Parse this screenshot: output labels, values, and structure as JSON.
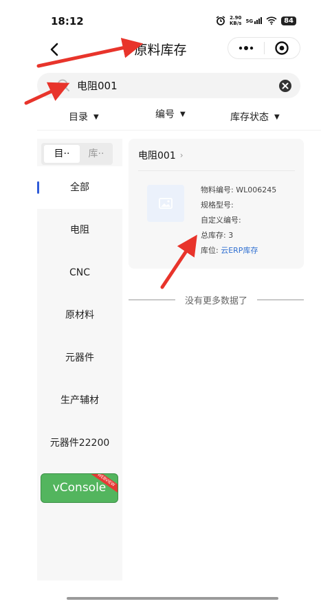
{
  "status_bar": {
    "time": "18:12",
    "net_speed_value": "2.90",
    "net_speed_unit": "KB/s",
    "network": "5G",
    "battery": "84"
  },
  "nav": {
    "title": "原料库存",
    "back_icon": "chevron-left-icon",
    "more_icon": "more-dots-icon",
    "close_icon": "target-close-icon"
  },
  "search": {
    "value": "电阻001",
    "icon": "search-icon",
    "clear_icon": "clear-icon"
  },
  "filters": [
    {
      "label": "目录"
    },
    {
      "label": "编号"
    },
    {
      "label": "库存状态"
    }
  ],
  "sidebar": {
    "tabs": [
      {
        "label": "目··"
      },
      {
        "label": "库··"
      }
    ],
    "items": [
      {
        "label": "全部"
      },
      {
        "label": "电阻"
      },
      {
        "label": "CNC"
      },
      {
        "label": "原材料"
      },
      {
        "label": "元器件"
      },
      {
        "label": "生产辅材"
      },
      {
        "label": "元器件22200"
      }
    ],
    "active_index": 0
  },
  "vconsole": {
    "label": "vConsole",
    "ribbon": "WEBVIEW"
  },
  "product": {
    "name": "电阻001",
    "code_label": "物料编号:",
    "code_value": "WL006245",
    "spec_label": "规格型号:",
    "custom_code_label": "自定义编号:",
    "stock_label": "总库存:",
    "stock_value": "3",
    "location_label": "库位:",
    "location_value": "云ERP库存"
  },
  "list_end": "没有更多数据了",
  "colors": {
    "accent": "#2f5bd8",
    "link": "#2f6fd1",
    "arrow": "#e8342b",
    "vconsole": "#53b55e"
  }
}
